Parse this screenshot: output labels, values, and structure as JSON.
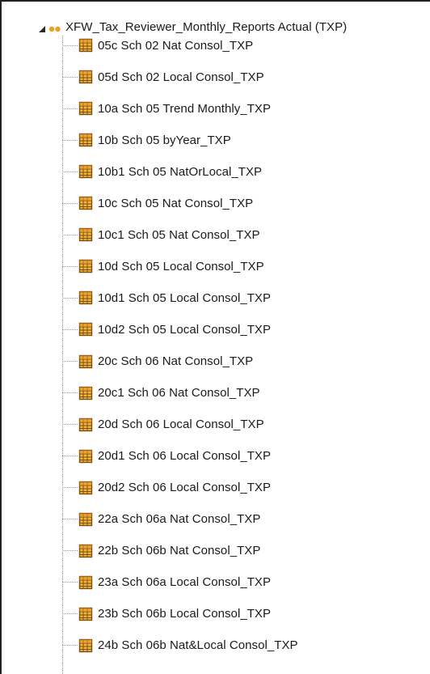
{
  "tree": {
    "root": {
      "label": "XFW_Tax_Reviewer_Monthly_Reports Actual (TXP)",
      "expanded": true,
      "icon": "cube-group-icon",
      "icon_color": "#f0a020"
    },
    "item_icon": "cube-view-icon",
    "item_icon_colors": {
      "fill": "#f4b638",
      "border": "#7a4e12"
    },
    "items": [
      {
        "label": "05c Sch 02 Nat Consol_TXP"
      },
      {
        "label": "05d Sch 02 Local Consol_TXP"
      },
      {
        "label": "10a Sch 05 Trend Monthly_TXP"
      },
      {
        "label": "10b Sch 05 byYear_TXP"
      },
      {
        "label": "10b1 Sch 05 NatOrLocal_TXP"
      },
      {
        "label": "10c Sch 05 Nat Consol_TXP"
      },
      {
        "label": "10c1 Sch 05 Nat Consol_TXP"
      },
      {
        "label": "10d Sch 05 Local Consol_TXP"
      },
      {
        "label": "10d1 Sch 05 Local Consol_TXP"
      },
      {
        "label": "10d2 Sch 05 Local Consol_TXP"
      },
      {
        "label": "20c Sch 06 Nat Consol_TXP"
      },
      {
        "label": "20c1 Sch 06 Nat Consol_TXP"
      },
      {
        "label": "20d Sch 06 Local Consol_TXP"
      },
      {
        "label": "20d1 Sch 06 Local Consol_TXP"
      },
      {
        "label": "20d2 Sch 06 Local Consol_TXP"
      },
      {
        "label": "22a Sch 06a Nat Consol_TXP"
      },
      {
        "label": "22b Sch 06b Nat Consol_TXP"
      },
      {
        "label": "23a Sch 06a Local Consol_TXP"
      },
      {
        "label": "23b Sch 06b Local Consol_TXP"
      },
      {
        "label": "24b Sch 06b Nat&Local Consol_TXP"
      }
    ]
  }
}
